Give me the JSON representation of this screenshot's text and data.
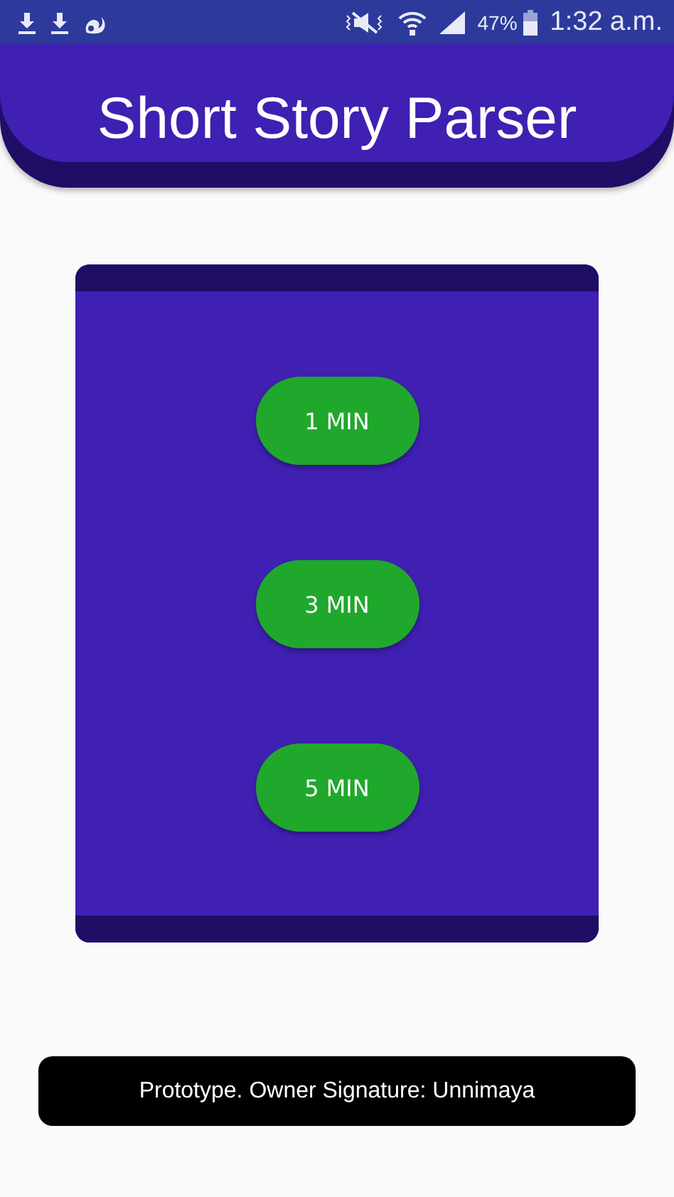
{
  "status_bar": {
    "battery_text": "47%",
    "time": "1:32 a.m."
  },
  "header": {
    "title": "Short Story Parser"
  },
  "duration_buttons": [
    {
      "label": "1 MIN"
    },
    {
      "label": "3 MIN"
    },
    {
      "label": "5 MIN"
    }
  ],
  "footer": {
    "text": "Prototype. Owner Signature: Unnimaya"
  }
}
